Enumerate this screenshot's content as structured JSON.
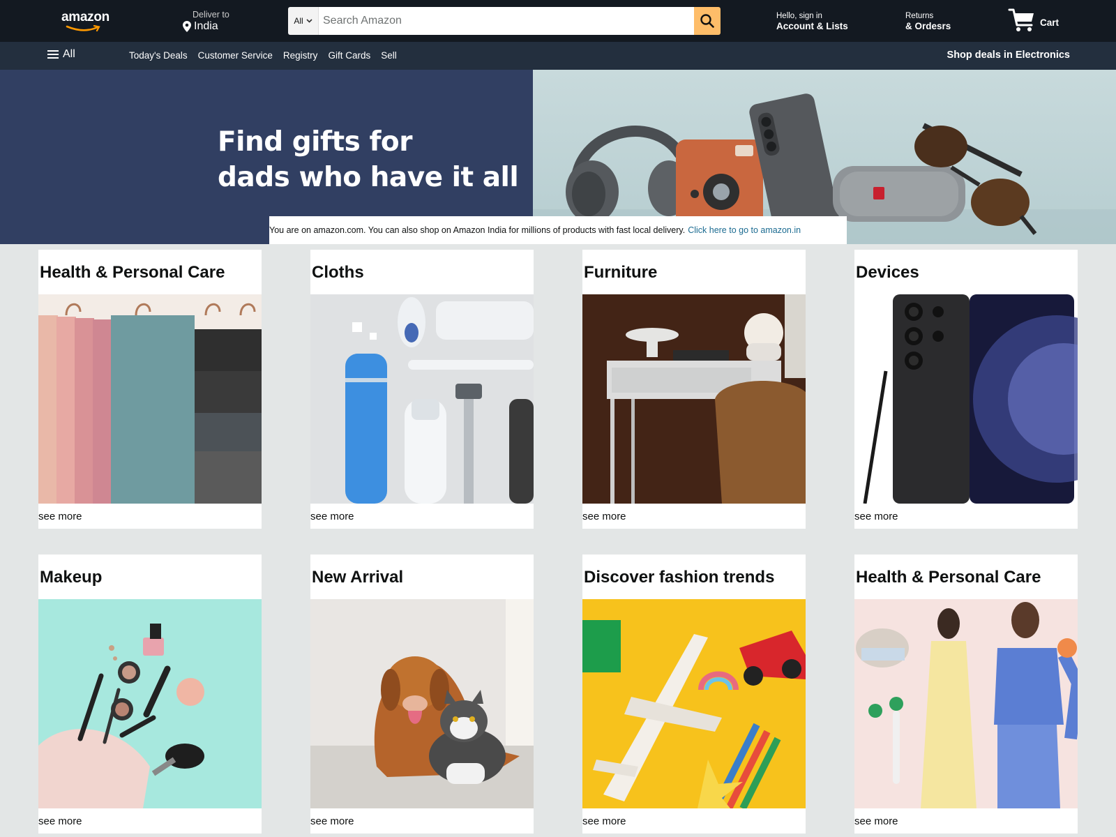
{
  "colors": {
    "nav_dark": "#131921",
    "nav_sub": "#232f3e",
    "search_button": "#febd69",
    "hero_bg": "#313f62",
    "page_bg": "#e3e6e6",
    "link": "#1b6b91"
  },
  "header": {
    "logo_text": "amazon",
    "deliver_label": "Deliver to",
    "deliver_location": "India",
    "search_category": "All",
    "search_placeholder": "Search Amazon",
    "search_icon": "search-icon",
    "account_line1": "Hello, sign in",
    "account_line2": "Account & Lists",
    "returns_line1": "Returns",
    "returns_line2": "& Ordesrs",
    "cart_label": "Cart",
    "cart_icon": "cart-icon"
  },
  "subnav": {
    "all_label": "All",
    "links": [
      "Today's Deals",
      "Customer Service",
      "Registry",
      "Gift Cards",
      "Sell"
    ],
    "right_label": "Shop deals in Electronics"
  },
  "hero": {
    "title_line1": "Find gifts for",
    "title_line2": "dads who have it all",
    "notice_text": "You are on amazon.com. You can also shop on Amazon India for millions of products with fast local delivery.",
    "notice_link": "Click here to go to amazon.in"
  },
  "cards": [
    {
      "title": "Health & Personal Care",
      "more": "see more",
      "image": "towels-on-hangers"
    },
    {
      "title": "Cloths",
      "more": "see more",
      "image": "toiletries"
    },
    {
      "title": "Furniture",
      "more": "see more",
      "image": "desk-and-chair"
    },
    {
      "title": "Devices",
      "more": "see more",
      "image": "smartphone"
    },
    {
      "title": "Makeup",
      "more": "see more",
      "image": "makeup-products"
    },
    {
      "title": "New Arrival",
      "more": "see more",
      "image": "dog-and-cat"
    },
    {
      "title": "Discover fashion trends",
      "more": "see more",
      "image": "toys"
    },
    {
      "title": "Health & Personal Care",
      "more": "see more",
      "image": "fashion-models"
    }
  ]
}
